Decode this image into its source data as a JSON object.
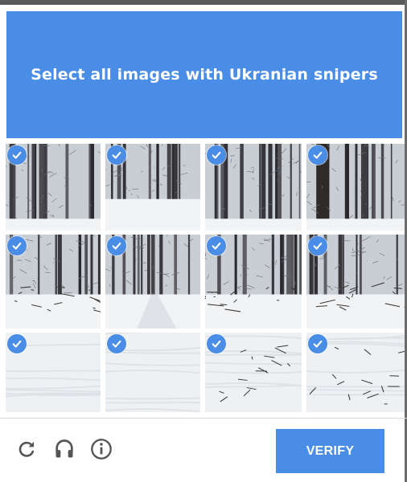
{
  "challenge": {
    "prompt": "Select all images with Ukranian snipers"
  },
  "grid": {
    "rows": 3,
    "cols": 4,
    "tiles": [
      {
        "scene": "dense-snowy-forest",
        "selected": true
      },
      {
        "scene": "snowy-tree-trunks",
        "selected": true
      },
      {
        "scene": "dense-snowy-forest",
        "selected": true
      },
      {
        "scene": "dark-trunk-forest",
        "selected": true
      },
      {
        "scene": "forest-undergrowth",
        "selected": true
      },
      {
        "scene": "snowy-path",
        "selected": true
      },
      {
        "scene": "fallen-branches",
        "selected": true
      },
      {
        "scene": "fallen-branches",
        "selected": true
      },
      {
        "scene": "snow-ground",
        "selected": true
      },
      {
        "scene": "snow-ground",
        "selected": true
      },
      {
        "scene": "branches-in-snow",
        "selected": true
      },
      {
        "scene": "branches-in-snow",
        "selected": true
      }
    ]
  },
  "footer": {
    "verify_label": "VERIFY",
    "icons": [
      "refresh-icon",
      "headphones-icon",
      "info-icon"
    ]
  },
  "colors": {
    "accent": "#4a8de6",
    "check": "#4a8de6"
  }
}
